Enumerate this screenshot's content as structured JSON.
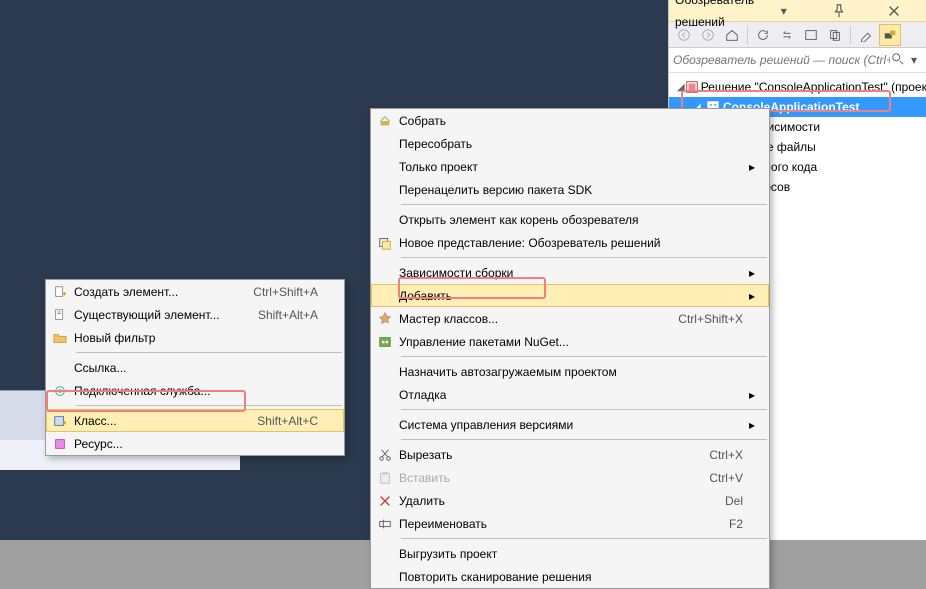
{
  "solution_explorer": {
    "title": "Обозреватель решений",
    "search_placeholder": "Обозреватель решений — поиск (Ctrl+;)",
    "solution_label": "Решение \"ConsoleApplicationTest\"  (проек",
    "project_label": "ConsoleApplicationTest",
    "child_hints": [
      "е зависимости",
      "очные файлы",
      "сходного кода",
      "ресурсов"
    ]
  },
  "main_menu": {
    "items": [
      {
        "label": "Собрать",
        "icon": "build-icon"
      },
      {
        "label": "Пересобрать"
      },
      {
        "label": "Только проект",
        "submenu": true
      },
      {
        "label": "Перенацелить версию пакета SDK"
      },
      "---",
      {
        "label": "Открыть элемент как корень обозревателя"
      },
      {
        "label": "Новое представление: Обозреватель решений",
        "icon": "new-view-icon"
      },
      "---",
      {
        "label": "Зависимости сборки",
        "submenu": true
      },
      {
        "label": "Добавить",
        "submenu": true,
        "highlight": true,
        "hover": true
      },
      {
        "label": "Мастер классов...",
        "icon": "class-wizard-icon",
        "shortcut": "Ctrl+Shift+X"
      },
      {
        "label": "Управление пакетами NuGet...",
        "icon": "nuget-icon"
      },
      "---",
      {
        "label": "Назначить автозагружаемым проектом"
      },
      {
        "label": "Отладка",
        "submenu": true
      },
      "---",
      {
        "label": "Система управления версиями",
        "submenu": true
      },
      "---",
      {
        "label": "Вырезать",
        "icon": "cut-icon",
        "shortcut": "Ctrl+X"
      },
      {
        "label": "Вставить",
        "icon": "paste-icon",
        "shortcut": "Ctrl+V",
        "disabled": true
      },
      {
        "label": "Удалить",
        "icon": "delete-icon",
        "shortcut": "Del"
      },
      {
        "label": "Переименовать",
        "icon": "rename-icon",
        "shortcut": "F2"
      },
      "---",
      {
        "label": "Выгрузить проект"
      },
      {
        "label": "Повторить сканирование решения"
      }
    ]
  },
  "sub_menu": {
    "items": [
      {
        "label": "Создать элемент...",
        "icon": "new-item-icon",
        "shortcut": "Ctrl+Shift+A"
      },
      {
        "label": "Существующий элемент...",
        "icon": "existing-item-icon",
        "shortcut": "Shift+Alt+A"
      },
      {
        "label": "Новый фильтр",
        "icon": "new-filter-icon"
      },
      "---",
      {
        "label": "Ссылка..."
      },
      {
        "label": "Подключенная служба...",
        "icon": "connected-service-icon"
      },
      "---",
      {
        "label": "Класс...",
        "icon": "class-icon",
        "shortcut": "Shift+Alt+C",
        "highlight": true,
        "hover": true
      },
      {
        "label": "Ресурс...",
        "icon": "resource-icon"
      }
    ]
  }
}
